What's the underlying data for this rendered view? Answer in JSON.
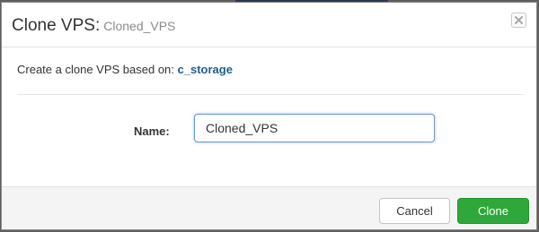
{
  "dialog": {
    "title": "Clone VPS:",
    "subtitle": "Cloned_VPS",
    "close_icon": "close-icon"
  },
  "body": {
    "intro_text": "Create a clone VPS based on:",
    "source_name": "c_storage",
    "name_label": "Name:",
    "name_value": "Cloned_VPS"
  },
  "footer": {
    "cancel_label": "Cancel",
    "clone_label": "Clone"
  },
  "colors": {
    "primary_button": "#2ea83a",
    "link": "#1f5e8c",
    "input_focus_border": "#6a9ad0"
  }
}
